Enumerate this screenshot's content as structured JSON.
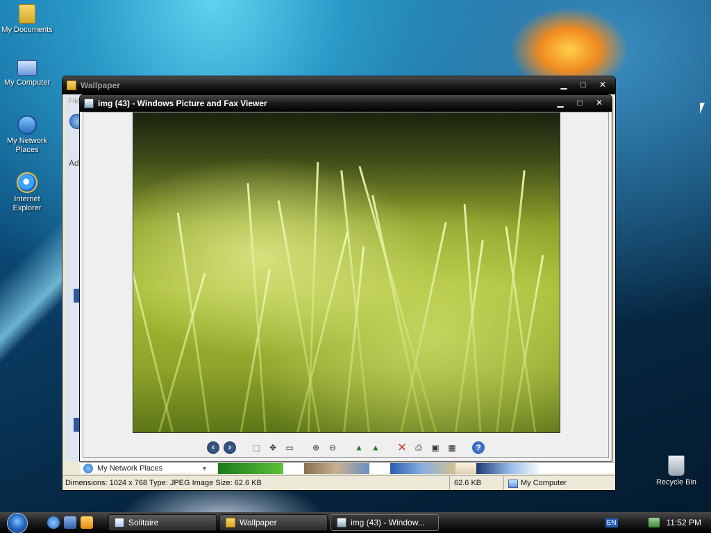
{
  "desktop": {
    "icons": [
      {
        "label": "My Documents",
        "icon": "folder-icon"
      },
      {
        "label": "My Computer",
        "icon": "computer-icon"
      },
      {
        "label": "My Network Places",
        "icon": "network-icon"
      },
      {
        "label": "Internet Explorer",
        "icon": "ie-icon"
      },
      {
        "label": "Recycle Bin",
        "icon": "recycle-bin-icon"
      }
    ]
  },
  "back_window": {
    "title": "Wallpaper",
    "menu_fragment": "File",
    "address_fragment": "Ad",
    "folder_bar_label": "My Network Places",
    "status": {
      "info": "Dimensions: 1024 x 768 Type: JPEG Image Size: 62.6 KB",
      "size": "62.6 KB",
      "zone": "My Computer"
    }
  },
  "front_window": {
    "title": "img (43) - Windows Picture and Fax Viewer",
    "toolbar": [
      {
        "name": "previous-image-button",
        "glyph": "‹"
      },
      {
        "name": "next-image-button",
        "glyph": "›"
      },
      {
        "name": "best-fit-button",
        "glyph": "⬚"
      },
      {
        "name": "actual-size-button",
        "glyph": "✥"
      },
      {
        "name": "slideshow-button",
        "glyph": "▭"
      },
      {
        "name": "zoom-in-button",
        "glyph": "⊕"
      },
      {
        "name": "zoom-out-button",
        "glyph": "⊖"
      },
      {
        "name": "rotate-clockwise-button",
        "glyph": "▲"
      },
      {
        "name": "rotate-counterclockwise-button",
        "glyph": "▲"
      },
      {
        "name": "delete-button",
        "glyph": "✕"
      },
      {
        "name": "print-button",
        "glyph": "⎙"
      },
      {
        "name": "save-copy-button",
        "glyph": "▣"
      },
      {
        "name": "open-for-editing-button",
        "glyph": "▦"
      },
      {
        "name": "help-button",
        "glyph": "?"
      }
    ]
  },
  "taskbar": {
    "tasks": [
      {
        "label": "Solitaire"
      },
      {
        "label": "Wallpaper"
      },
      {
        "label": "img (43) - Window..."
      }
    ],
    "language": "EN",
    "clock": "11:52 PM"
  },
  "colors": {
    "titlebar_dark": "#000000",
    "taskbar": "#202020",
    "desktop_blue": "#0a3d66"
  }
}
